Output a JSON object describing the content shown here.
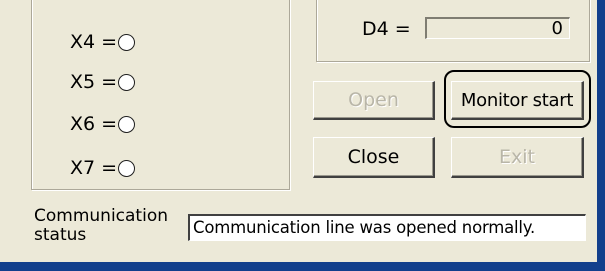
{
  "inputs": [
    {
      "label": "X4 ="
    },
    {
      "label": "X5 ="
    },
    {
      "label": "X6 ="
    },
    {
      "label": "X7 ="
    }
  ],
  "device": {
    "label": "D4 =",
    "value": "0"
  },
  "buttons": {
    "open": "Open",
    "monitor_start": "Monitor start",
    "close": "Close",
    "exit": "Exit"
  },
  "communication": {
    "label_line1": "Communication",
    "label_line2": "status",
    "status_text": "Communication line was opened normally."
  },
  "colors": {
    "dialog_bg": "#ece9d8",
    "window_frame": "#123f8c"
  }
}
